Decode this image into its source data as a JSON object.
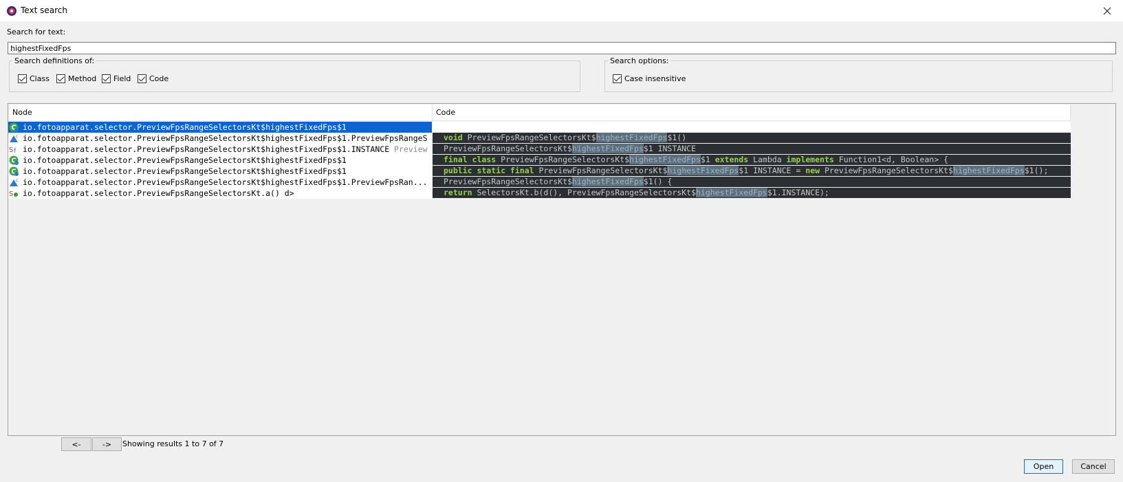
{
  "window": {
    "title": "Text search"
  },
  "search": {
    "label": "Search for text:",
    "value": "highestFixedFps"
  },
  "definitions": {
    "legend": "Search definitions of:",
    "options": [
      {
        "label": "Class",
        "checked": true
      },
      {
        "label": "Method",
        "checked": true
      },
      {
        "label": "Field",
        "checked": true
      },
      {
        "label": "Code",
        "checked": true
      }
    ]
  },
  "search_options": {
    "legend": "Search options:",
    "options": [
      {
        "label": "Case insensitive",
        "checked": true
      }
    ]
  },
  "table": {
    "headers": {
      "node": "Node",
      "code": "Code"
    },
    "rows": [
      {
        "icon": "class-icon",
        "node": "io.fotoapparat.selector.PreviewFpsRangeSelectorsKt$highestFixedFps$1",
        "node_extra": "",
        "code": []
      },
      {
        "icon": "method-icon",
        "node": "io.fotoapparat.selector.PreviewFpsRangeSelectorsKt$highestFixedFps$1.PreviewFpsRangeS",
        "node_extra": "",
        "code": [
          {
            "t": "void",
            "k": "kw"
          },
          {
            "t": " PreviewFpsRangeSelectorsKt$"
          },
          {
            "t": "highestFixedFps",
            "k": "hl"
          },
          {
            "t": "$1()"
          }
        ]
      },
      {
        "icon": "field-icon",
        "node": "io.fotoapparat.selector.PreviewFpsRangeSelectorsKt$highestFixedFps$1.INSTANCE ",
        "node_extra": "Preview",
        "code": [
          {
            "t": "PreviewFpsRangeSelectorsKt$"
          },
          {
            "t": "highestFixedFps",
            "k": "hl"
          },
          {
            "t": "$1 INSTANCE"
          }
        ]
      },
      {
        "icon": "class-icon",
        "node": "io.fotoapparat.selector.PreviewFpsRangeSelectorsKt$highestFixedFps$1",
        "node_extra": "",
        "code": [
          {
            "t": "final class",
            "k": "kw"
          },
          {
            "t": " PreviewFpsRangeSelectorsKt$"
          },
          {
            "t": "highestFixedFps",
            "k": "hl"
          },
          {
            "t": "$1 "
          },
          {
            "t": "extends",
            "k": "kw"
          },
          {
            "t": " Lambda "
          },
          {
            "t": "implements",
            "k": "kw"
          },
          {
            "t": " Function1<d, Boolean> {"
          }
        ]
      },
      {
        "icon": "class-icon",
        "node": "io.fotoapparat.selector.PreviewFpsRangeSelectorsKt$highestFixedFps$1",
        "node_extra": "",
        "code": [
          {
            "t": "public static final",
            "k": "kw"
          },
          {
            "t": " PreviewFpsRangeSelectorsKt$"
          },
          {
            "t": "highestFixedFps",
            "k": "hl"
          },
          {
            "t": "$1 INSTANCE = "
          },
          {
            "t": "new",
            "k": "kw"
          },
          {
            "t": " PreviewFpsRangeSelectorsKt$"
          },
          {
            "t": "highestFixedFps",
            "k": "hl"
          },
          {
            "t": "$1();"
          }
        ]
      },
      {
        "icon": "method-icon",
        "node": "io.fotoapparat.selector.PreviewFpsRangeSelectorsKt$highestFixedFps$1.PreviewFpsRan...",
        "node_extra": "",
        "code": [
          {
            "t": "PreviewFpsRangeSelectorsKt$"
          },
          {
            "t": "highestFixedFps",
            "k": "hl"
          },
          {
            "t": "$1() {"
          }
        ]
      },
      {
        "icon": "static-method-icon",
        "node": "io.fotoapparat.selector.PreviewFpsRangeSelectorsKt.a() d>",
        "node_extra": "",
        "code": [
          {
            "t": "return",
            "k": "kw"
          },
          {
            "t": " SelectorsKt.b(d(), PreviewFpsRangeSelectorsKt$"
          },
          {
            "t": "highestFixedFps",
            "k": "hl"
          },
          {
            "t": "$1.INSTANCE);"
          }
        ]
      }
    ],
    "selected_index": 0
  },
  "pager": {
    "prev": "<-",
    "next": "->",
    "status": "Showing results 1 to 7 of 7"
  },
  "actions": {
    "open": "Open",
    "cancel": "Cancel"
  },
  "colors": {
    "selection": "#0a64d2",
    "code_bg": "#2b2f33",
    "keyword": "#97d24a",
    "match_highlight": "#5c6f7d"
  }
}
